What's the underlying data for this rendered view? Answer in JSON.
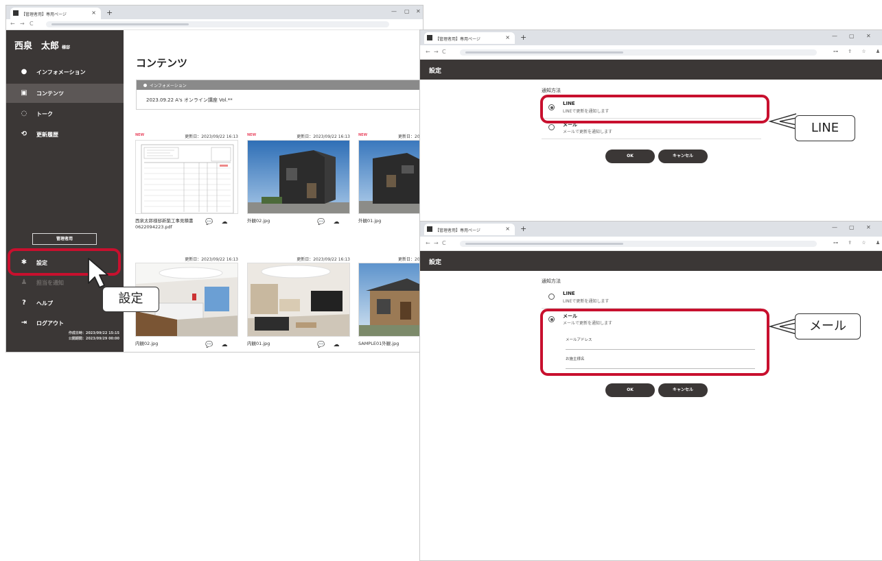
{
  "browser": {
    "tab_title": "【管理者用】専用ページ",
    "tab_close": "×",
    "new_tab": "+",
    "win_controls": [
      "﹀",
      "—",
      "▢",
      "✕"
    ],
    "nav": [
      "←",
      "→",
      "C",
      "🔒"
    ],
    "tools": "⊶ ⇪ ☆ ♟ ⋮"
  },
  "portal": {
    "user_name": "西泉　太郎",
    "user_suffix": "様邸",
    "nav": [
      {
        "label": "インフォメーション",
        "icon": "●"
      },
      {
        "label": "コンテンツ",
        "icon": "▣"
      },
      {
        "label": "トーク",
        "icon": "◌"
      },
      {
        "label": "更新履歴",
        "icon": "⟲"
      }
    ],
    "admin_button": "管理者用",
    "bottom_nav": [
      {
        "label": "設定",
        "icon": "✱"
      },
      {
        "label": "担当を通知",
        "icon": "♟"
      },
      {
        "label": "ヘルプ",
        "icon": "?"
      },
      {
        "label": "ログアウト",
        "icon": "⇥"
      }
    ],
    "created": "作成日時：2023/09/22 15:15",
    "published": "公開期間：2023/09/29 00:00",
    "page_title": "コンテンツ",
    "info_header": "インフォメーション",
    "info_line": "2023.09.22 A's オンライン講座 Vol.**",
    "cards": [
      {
        "new": "NEW",
        "updated": "更新日：2023/09/22 16:13",
        "file": "西泉太郎様邸新築工事見積書0622094223.pdf"
      },
      {
        "new": "NEW",
        "updated": "更新日：2023/09/22 16:13",
        "file": "外観02.jpg"
      },
      {
        "new": "NEW",
        "updated": "更新日：20",
        "file": "外観01.jpg"
      },
      {
        "new": "",
        "updated": "更新日：2023/09/22 16:13",
        "file": "内観02.jpg"
      },
      {
        "new": "",
        "updated": "更新日：2023/09/22 16:13",
        "file": "内観01.jpg"
      },
      {
        "new": "",
        "updated": "更新日：20",
        "file": "SAMPLE01外観.jpg"
      }
    ]
  },
  "settings": {
    "header": "設定",
    "method_label": "通知方法",
    "line_title": "LINE",
    "line_sub": "LINEで更新を通知します",
    "mail_title": "メール",
    "mail_sub": "メールで更新を通知します",
    "mail_address_label": "メールアドレス",
    "owner_name_label": "お施主様名",
    "ok": "OK",
    "cancel": "キャンセル"
  },
  "callouts": {
    "settei": "設定",
    "line": "LINE",
    "mail": "メール"
  },
  "colors": {
    "sidebar": "#3b3736",
    "highlight": "#c8102e",
    "new_badge": "#e94a63"
  }
}
